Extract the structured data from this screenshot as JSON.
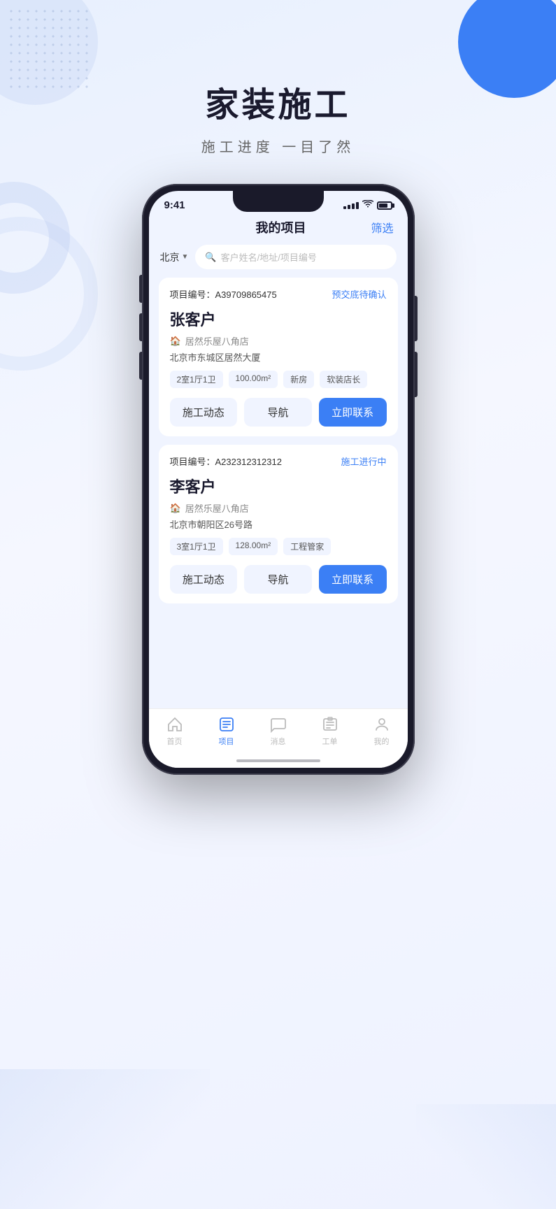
{
  "hero": {
    "title": "家装施工",
    "subtitle": "施工进度 一目了然"
  },
  "phone": {
    "status_bar": {
      "time": "9:41",
      "signal_bars": [
        3,
        5,
        7,
        9,
        11
      ],
      "wifi": "WiFi",
      "battery": "Battery"
    },
    "header": {
      "title": "我的项目",
      "filter": "筛选"
    },
    "search": {
      "city": "北京",
      "placeholder": "客户姓名/地址/项目编号"
    },
    "projects": [
      {
        "number_label": "项目编号：",
        "number": "A39709865475",
        "status": "预交底待确认",
        "status_type": "pending",
        "customer_name": "张客户",
        "store_name": "居然乐屋八角店",
        "address": "北京市东城区居然大厦",
        "tags": [
          "2室1厅1卫",
          "100.00m²",
          "新房",
          "软装店长"
        ],
        "btn1": "施工动态",
        "btn2": "导航",
        "btn3": "立即联系"
      },
      {
        "number_label": "项目编号：",
        "number": "A232312312312",
        "status": "施工进行中",
        "status_type": "inprogress",
        "customer_name": "李客户",
        "store_name": "居然乐屋八角店",
        "address": "北京市朝阳区26号路",
        "tags": [
          "3室1厅1卫",
          "128.00m²",
          "工程管家"
        ],
        "btn1": "施工动态",
        "btn2": "导航",
        "btn3": "立即联系"
      }
    ],
    "nav": {
      "items": [
        {
          "icon": "🏠",
          "label": "首页",
          "active": false
        },
        {
          "icon": "📋",
          "label": "项目",
          "active": true
        },
        {
          "icon": "💬",
          "label": "消息",
          "active": false
        },
        {
          "icon": "📝",
          "label": "工单",
          "active": false
        },
        {
          "icon": "👤",
          "label": "我的",
          "active": false
        }
      ]
    }
  }
}
